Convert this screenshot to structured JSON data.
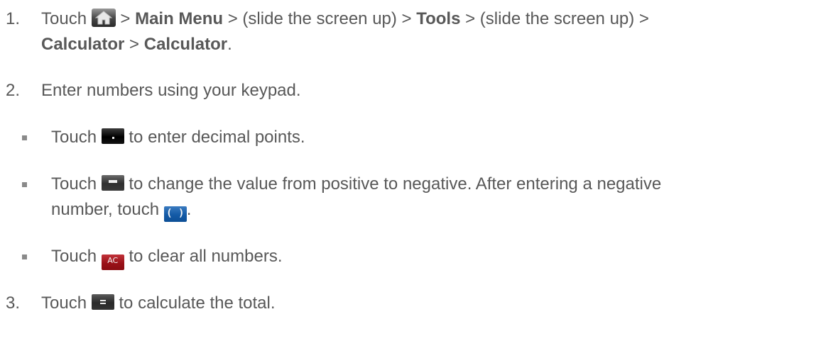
{
  "steps": [
    {
      "number": "1.",
      "touch": "Touch",
      "icon": "home-icon",
      "sep1": ">",
      "main_menu": "Main Menu",
      "sep2": "> (slide the screen up) >",
      "tools": "Tools",
      "sep3": "> (slide the screen up) >",
      "calculator_1": "Calculator",
      "sep4": ">",
      "calculator_2": "Calculator",
      "end": "."
    },
    {
      "number": "2.",
      "text": "Enter numbers using your keypad."
    },
    {
      "number": "3.",
      "touch": "Touch",
      "icon": "equals-key-icon",
      "text": "to calculate the total."
    }
  ],
  "bullets": [
    {
      "touch": "Touch",
      "icon": "decimal-key-icon",
      "text": "to enter decimal points."
    },
    {
      "touch": "Touch",
      "icon": "minus-key-icon",
      "text": "to change the value from positive to negative. After entering a negative",
      "continuation": "number, touch",
      "icon2": "parentheses-key-icon",
      "icon2_label": "( )",
      "end": "."
    },
    {
      "touch": "Touch",
      "icon": "ac-key-icon",
      "icon_label": "AC",
      "text": "to clear all numbers."
    }
  ],
  "colors": {
    "text": "#585858",
    "bullet": "#8a8a8a",
    "ac_key": "#9a1219",
    "paren_key": "#135aa6"
  }
}
